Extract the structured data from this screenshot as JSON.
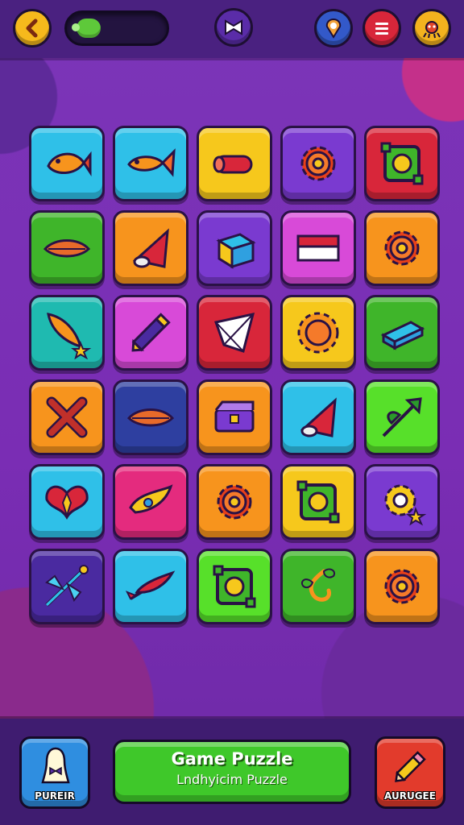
{
  "header": {
    "back_icon": "chevron-left-icon",
    "toggle_state": "on",
    "mode_icon": "bowtie-icon",
    "pin_icon": "map-pin-icon",
    "menu_icon": "menu-icon",
    "bug_icon": "bug-icon"
  },
  "colors": {
    "yellow": "#f6c81c",
    "orange": "#f7941d",
    "red": "#d8263a",
    "green": "#3fb52a",
    "lime": "#57e02a",
    "cyan": "#2fc0e8",
    "teal": "#1fbab0",
    "purple": "#7a3ad0",
    "magenta": "#d84ad8",
    "pink": "#e42b7e",
    "navy": "#2e3fa0",
    "indigo": "#4a2aa0"
  },
  "grid": {
    "rows": [
      [
        {
          "color": "cyan",
          "icon": "fish-icon"
        },
        {
          "color": "cyan",
          "icon": "goldfish-icon"
        },
        {
          "color": "yellow",
          "icon": "log-icon"
        },
        {
          "color": "purple",
          "icon": "gear-icon"
        },
        {
          "color": "red",
          "icon": "square-frame-icon"
        }
      ],
      [
        {
          "color": "green",
          "icon": "leaf-icon"
        },
        {
          "color": "orange",
          "icon": "cone-icon"
        },
        {
          "color": "purple",
          "icon": "star-box-icon"
        },
        {
          "color": "magenta",
          "icon": "flag-icon"
        },
        {
          "color": "orange",
          "icon": "gear-icon"
        }
      ],
      [
        {
          "color": "teal",
          "icon": "feather-star-icon"
        },
        {
          "color": "magenta",
          "icon": "crayon-icon"
        },
        {
          "color": "red",
          "icon": "paper-kite-icon"
        },
        {
          "color": "yellow",
          "icon": "sun-gear-icon"
        },
        {
          "color": "green",
          "icon": "block-icon"
        }
      ],
      [
        {
          "color": "orange",
          "icon": "x-ribbon-icon"
        },
        {
          "color": "navy",
          "icon": "leaf-icon"
        },
        {
          "color": "orange",
          "icon": "chest-icon"
        },
        {
          "color": "cyan",
          "icon": "cone-icon"
        },
        {
          "color": "lime",
          "icon": "arrow-plant-icon"
        }
      ],
      [
        {
          "color": "cyan",
          "icon": "wings-icon"
        },
        {
          "color": "pink",
          "icon": "bird-icon"
        },
        {
          "color": "orange",
          "icon": "gear-icon"
        },
        {
          "color": "yellow",
          "icon": "square-frame-icon"
        },
        {
          "color": "purple",
          "icon": "gear-star-icon"
        }
      ],
      [
        {
          "color": "indigo",
          "icon": "dragonfly-icon"
        },
        {
          "color": "cyan",
          "icon": "fish-bone-icon"
        },
        {
          "color": "lime",
          "icon": "square-frame-icon"
        },
        {
          "color": "green",
          "icon": "vine-icon"
        },
        {
          "color": "orange",
          "icon": "gear-icon"
        }
      ]
    ]
  },
  "footer": {
    "player_label": "PUREIR",
    "player_icon": "player-icon",
    "title": "Game Puzzle",
    "subtitle": "Lndhyicim Puzzle",
    "upgrade_label": "AURUGEE",
    "upgrade_icon": "pencil-icon"
  }
}
